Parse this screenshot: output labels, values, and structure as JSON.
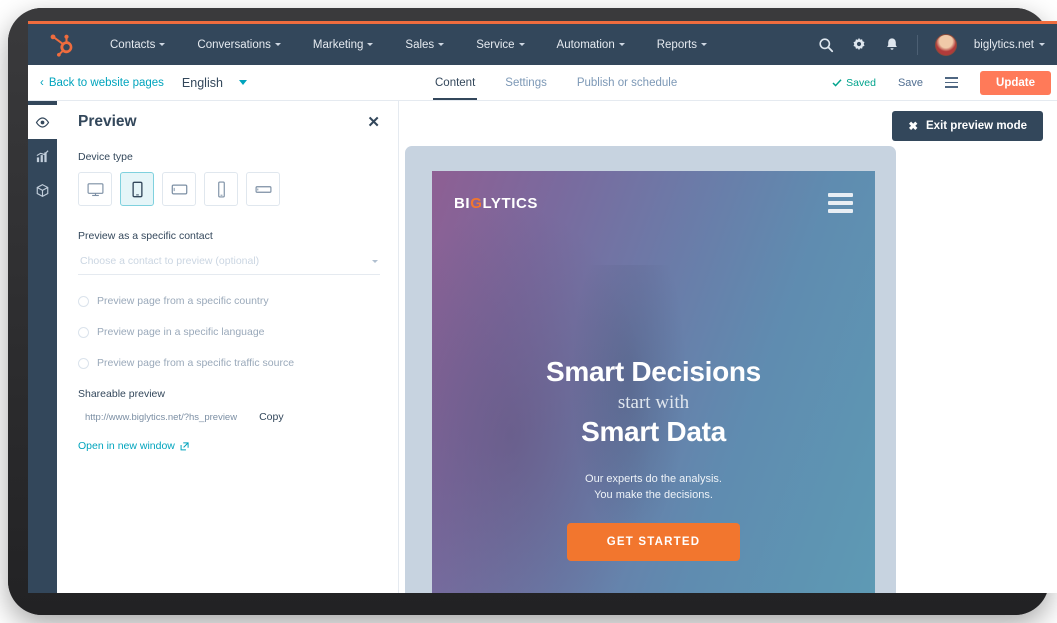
{
  "topnav": {
    "logo_icon": "hubspot-sprocket-icon",
    "items": [
      {
        "label": "Contacts"
      },
      {
        "label": "Conversations"
      },
      {
        "label": "Marketing"
      },
      {
        "label": "Sales"
      },
      {
        "label": "Service"
      },
      {
        "label": "Automation"
      },
      {
        "label": "Reports"
      }
    ],
    "search_icon": "search-icon",
    "settings_icon": "gear-icon",
    "notifications_icon": "bell-icon",
    "account": "biglytics.net",
    "accent_color": "#ff7a59",
    "bg_color": "#33475b"
  },
  "subbar": {
    "back_label": "Back to website pages",
    "language": "English",
    "tabs": [
      {
        "label": "Content",
        "active": true
      },
      {
        "label": "Settings",
        "active": false
      },
      {
        "label": "Publish or schedule",
        "active": false
      }
    ],
    "saved_label": "Saved",
    "save_label": "Save",
    "update_label": "Update",
    "link_color": "#00a4bd",
    "saved_color": "#00a38c"
  },
  "rail": {
    "items": [
      {
        "icon": "eye-icon",
        "active": true
      },
      {
        "icon": "analytics-chart-icon",
        "active": false
      },
      {
        "icon": "cube-box-icon",
        "active": false
      }
    ]
  },
  "panel": {
    "title": "Preview",
    "close_icon": "close-icon",
    "device_type_label": "Device type",
    "devices": [
      {
        "icon": "desktop-icon",
        "selected": false
      },
      {
        "icon": "tablet-portrait-icon",
        "selected": true
      },
      {
        "icon": "tablet-landscape-icon",
        "selected": false
      },
      {
        "icon": "phone-portrait-icon",
        "selected": false
      },
      {
        "icon": "phone-landscape-icon",
        "selected": false
      }
    ],
    "contact_label": "Preview as a specific contact",
    "contact_placeholder": "Choose a contact to preview (optional)",
    "options": [
      {
        "label": "Preview page from a specific country"
      },
      {
        "label": "Preview page in a specific language"
      },
      {
        "label": "Preview page from a specific traffic source"
      }
    ],
    "shareable_label": "Shareable preview",
    "shareable_url": "http://www.biglytics.net/?hs_preview",
    "copy_label": "Copy",
    "open_label": "Open in new window",
    "selected_device_color": "#7fd1de"
  },
  "stage": {
    "exit_label": "Exit preview mode",
    "exit_icon": "close-x-icon",
    "bezel_color": "#c7d3e0"
  },
  "preview_page": {
    "logo_pre": "BI",
    "logo_g": "G",
    "logo_post": "LYTICS",
    "menu_icon": "hamburger-menu-icon",
    "heading_line1": "Smart Decisions",
    "heading_line2": "start with",
    "heading_line3": "Smart Data",
    "sub_line1": "Our experts do the analysis.",
    "sub_line2": "You make the decisions.",
    "cta_label": "GET STARTED",
    "cta_color": "#f2762e"
  }
}
